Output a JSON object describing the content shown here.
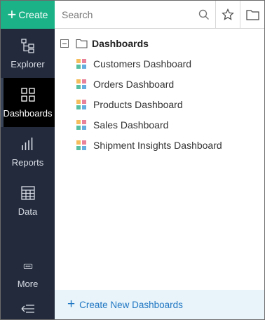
{
  "sidebar": {
    "create_label": "Create",
    "items": [
      {
        "label": "Explorer",
        "icon": "explorer-icon"
      },
      {
        "label": "Dashboards",
        "icon": "dashboards-icon",
        "active": true
      },
      {
        "label": "Reports",
        "icon": "reports-icon"
      },
      {
        "label": "Data",
        "icon": "data-icon"
      },
      {
        "label": "More",
        "icon": "more-icon"
      }
    ],
    "collapse_icon": "collapse-sidebar-icon"
  },
  "search": {
    "placeholder": "Search",
    "icons": [
      "search-icon",
      "star-icon",
      "folder-icon"
    ]
  },
  "tree": {
    "root_label": "Dashboards",
    "items": [
      {
        "label": "Customers Dashboard",
        "icon": "dashboard-icon"
      },
      {
        "label": "Orders Dashboard",
        "icon": "dashboard-icon"
      },
      {
        "label": "Products Dashboard",
        "icon": "dashboard-icon"
      },
      {
        "label": "Sales Dashboard",
        "icon": "dashboard-icon"
      },
      {
        "label": "Shipment Insights Dashboard",
        "icon": "dashboard-icon"
      }
    ]
  },
  "footer": {
    "create_new_label": "Create New Dashboards"
  },
  "colors": {
    "sidebar_bg": "#222a3b",
    "create_green": "#1cb287",
    "active_bg": "#000000",
    "link_blue": "#1f76c2",
    "footer_bg": "#e8f4fa"
  }
}
